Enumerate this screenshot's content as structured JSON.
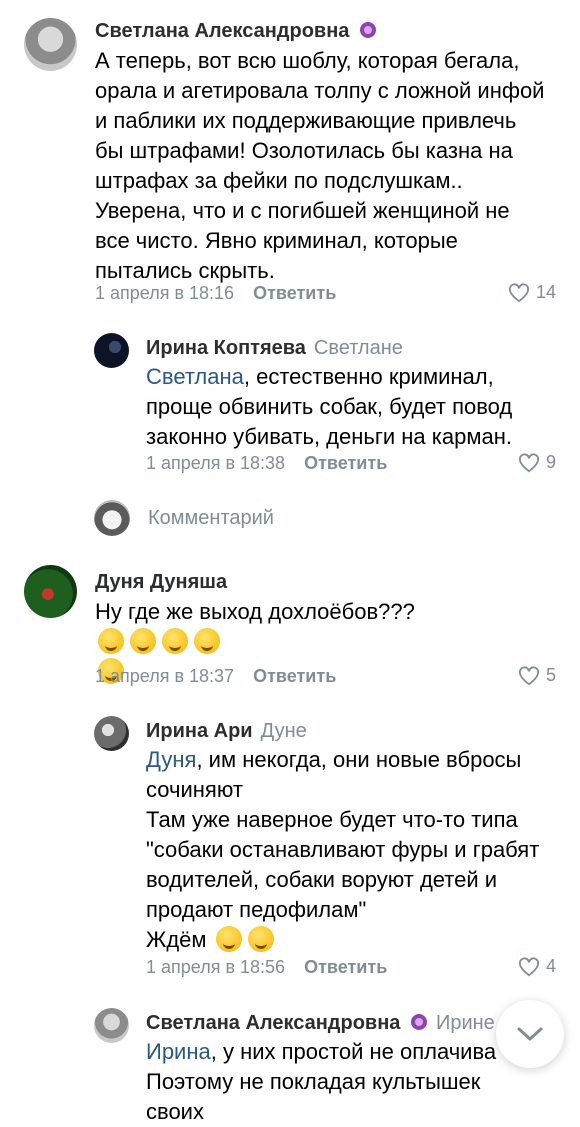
{
  "comments": [
    {
      "author": "Светлана Александровна",
      "text": "А теперь, вот всю шоблу, которая бегала, орала и агетировала толпу с ложной инфой и паблики их поддерживающие привлечь бы штрафами! Озолотилась бы казна на штрафах за фейки по подслушкам.. Уверена, что и с погибшей женщиной не все чисто. Явно криминал, которые пытались скрыть.",
      "date": "1 апреля в 18:16",
      "reply_label": "Ответить",
      "likes": "14"
    },
    {
      "author": "Ирина Коптяева",
      "to": "Светлане",
      "mention": "Светлана",
      "text": ", естественно криминал, проще обвинить собак, будет повод законно убивать, деньги на карман.",
      "date": "1 апреля в 18:38",
      "reply_label": "Ответить",
      "likes": "9"
    },
    {
      "author": "Дуня Дуняша",
      "text": "Ну где же выход дохлоёбов???",
      "date": "1 апреля в 18:37",
      "reply_label": "Ответить",
      "likes": "5"
    },
    {
      "author": "Ирина Ари",
      "to": "Дуне",
      "mention": "Дуня",
      "text_first": ", им некогда, они новые вбросы сочиняют",
      "text_rest": "Там уже наверное будет что-то типа \"собаки останавливают фуры и грабят водителей, собаки воруют детей и продают педофилам\"",
      "text_end": "Ждём",
      "date": "1 апреля в 18:56",
      "reply_label": "Ответить",
      "likes": "4"
    },
    {
      "author": "Светлана Александровна",
      "to": "Ирине",
      "mention": "Ирина",
      "text": ", у них простой не оплачива",
      "text_cut": "Поэтому не покладая культышек своих"
    }
  ],
  "composer": {
    "placeholder": "Комментарий"
  },
  "colors": {
    "name": "#2c2d2e",
    "meta": "#818c99",
    "link": "#2a5885",
    "badge": "#8e44ad"
  },
  "icons": [
    "heart-icon",
    "purple-badge-icon",
    "rofl-emoji-icon",
    "thinking-emoji-icon",
    "grin-emoji-icon",
    "chevron-down-icon"
  ]
}
